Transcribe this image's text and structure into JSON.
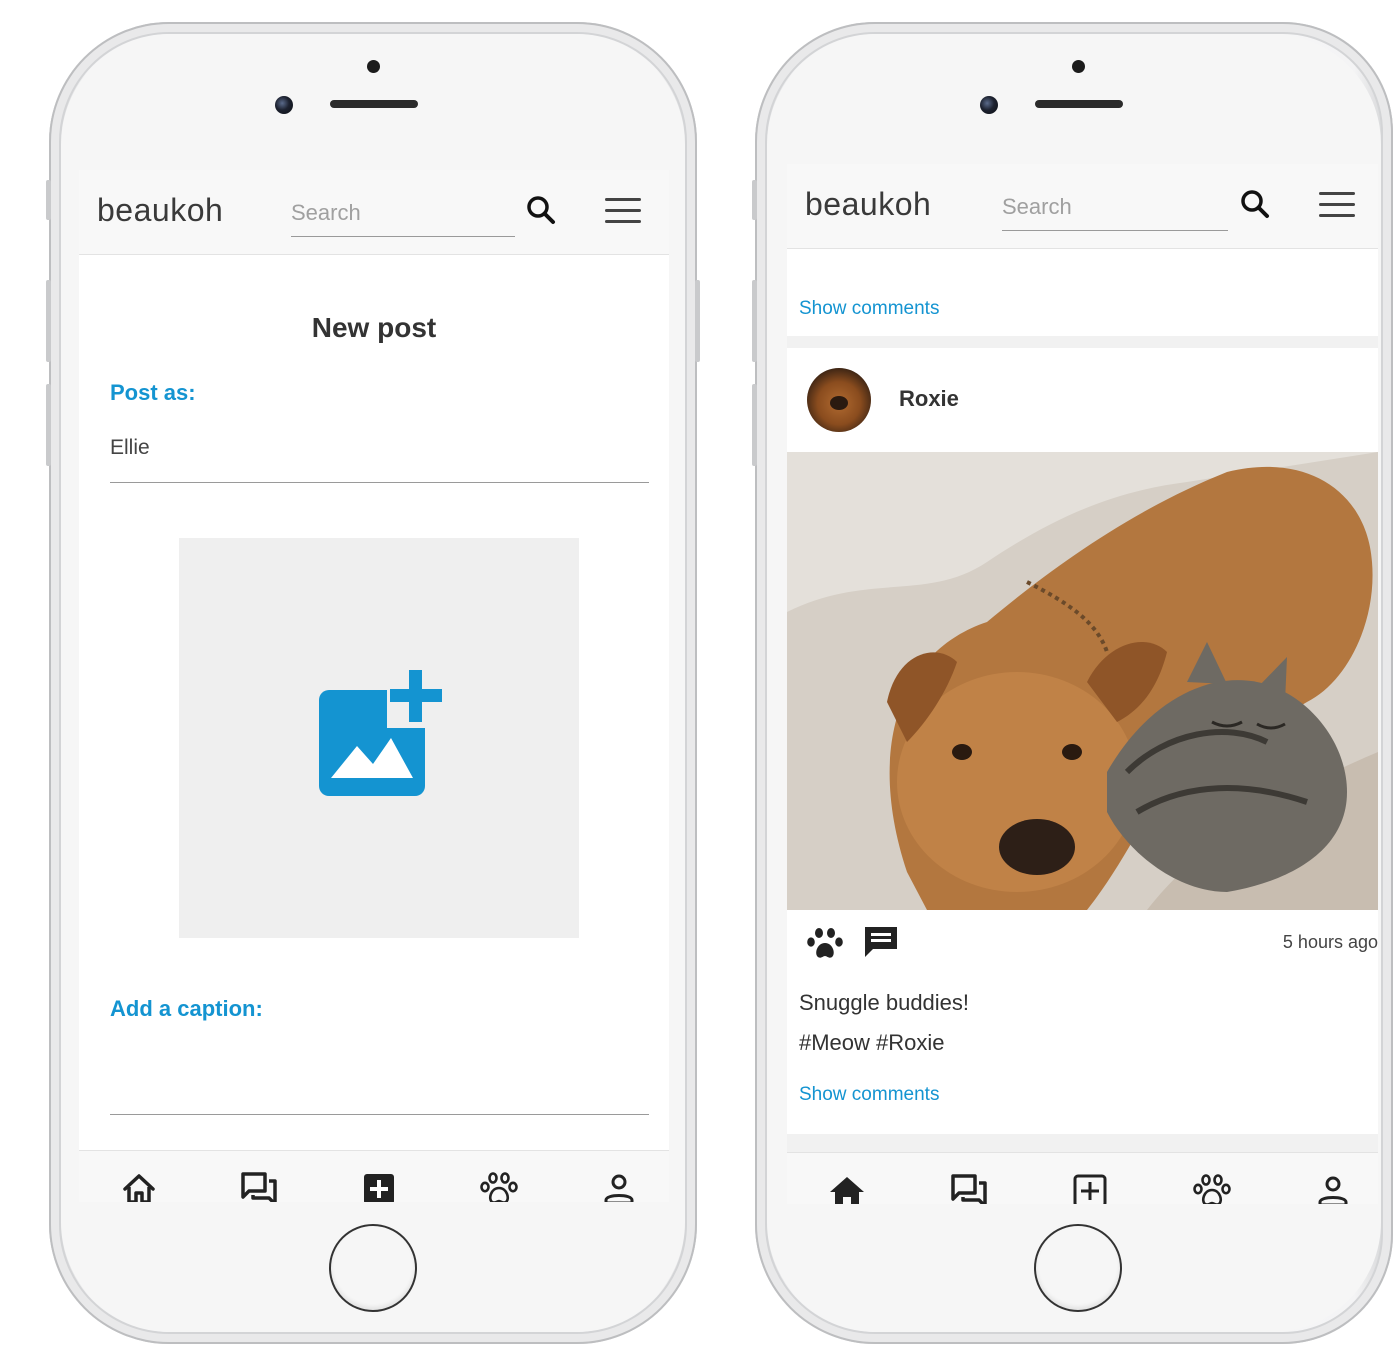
{
  "colors": {
    "accent": "#1494d1",
    "text": "#333333",
    "bar": "#f8f8f8"
  },
  "left_phone": {
    "brand": "beaukoh",
    "search_placeholder": "Search",
    "page_title": "New post",
    "post_as_label": "Post as:",
    "post_as_value": "Ellie",
    "upload_icon": "add-photo-icon",
    "caption_label": "Add a caption:",
    "nav": [
      "home-icon",
      "chat-icon",
      "add-icon",
      "paw-icon",
      "profile-icon"
    ]
  },
  "right_phone": {
    "brand": "beaukoh",
    "search_placeholder": "Search",
    "show_comments_top": "Show comments",
    "post": {
      "author": "Roxie",
      "timestamp": "5 hours ago",
      "caption_line1": "Snuggle buddies!",
      "caption_line2": "#Meow #Roxie",
      "show_comments": "Show comments"
    },
    "nav": [
      "home-icon",
      "chat-icon",
      "add-icon",
      "paw-icon",
      "profile-icon"
    ]
  }
}
